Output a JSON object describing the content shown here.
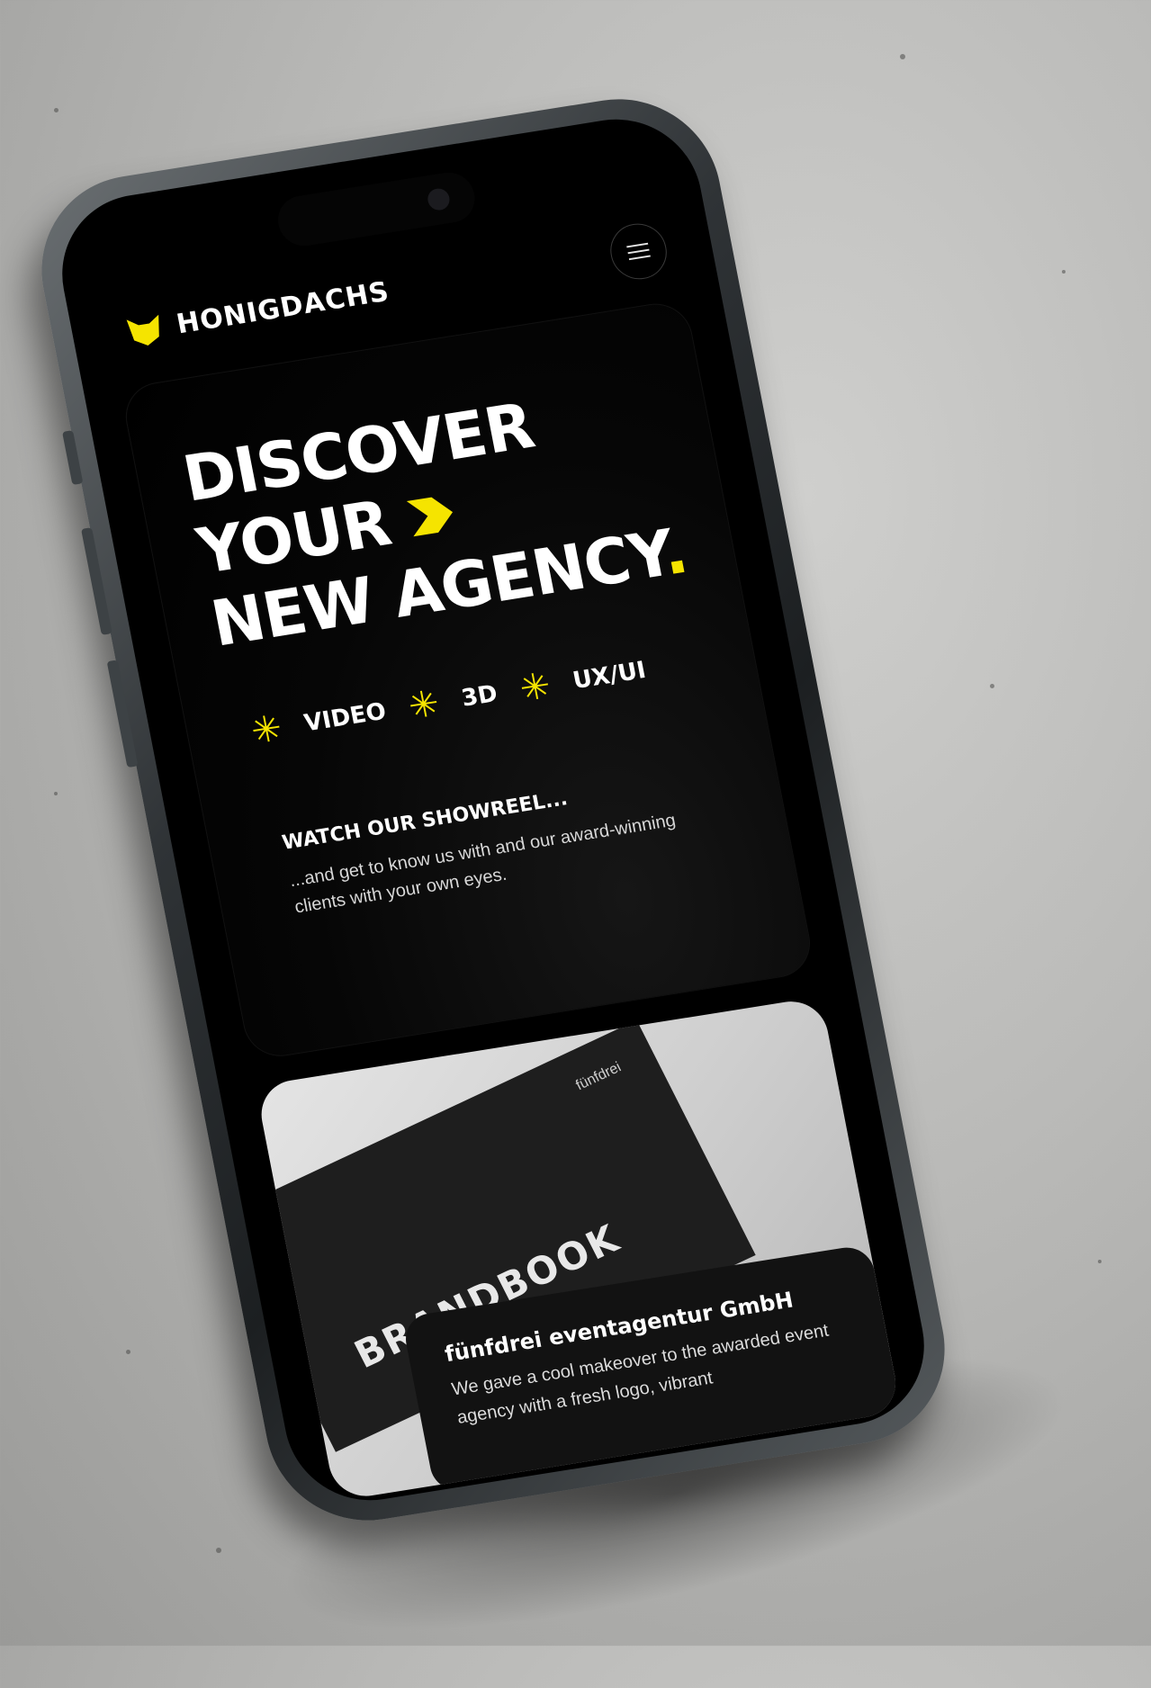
{
  "header": {
    "brand": "HONIGDACHS",
    "logo_icon": "badger-logo-icon",
    "menu_icon": "hamburger-menu-icon"
  },
  "hero": {
    "headline_line1": "DISCOVER",
    "headline_line2": "YOUR",
    "headline_line3": "NEW AGENCY",
    "headline_dot": ".",
    "tags": [
      "VIDEO",
      "3D",
      "UX/UI"
    ],
    "tag_icon": "asterisk-icon",
    "showreel_title": "WATCH OUR SHOWREEL...",
    "showreel_text": "...and get to know us with and our award-winning clients with your own eyes."
  },
  "project": {
    "image_label": "BRANDBOOK",
    "image_brand": "fünfdrei",
    "title": "fünfdrei eventagentur GmbH",
    "description": "We gave a cool makeover to the awarded event agency with a fresh logo, vibrant"
  },
  "colors": {
    "accent": "#f5e400",
    "background": "#000000",
    "text": "#ffffff"
  }
}
